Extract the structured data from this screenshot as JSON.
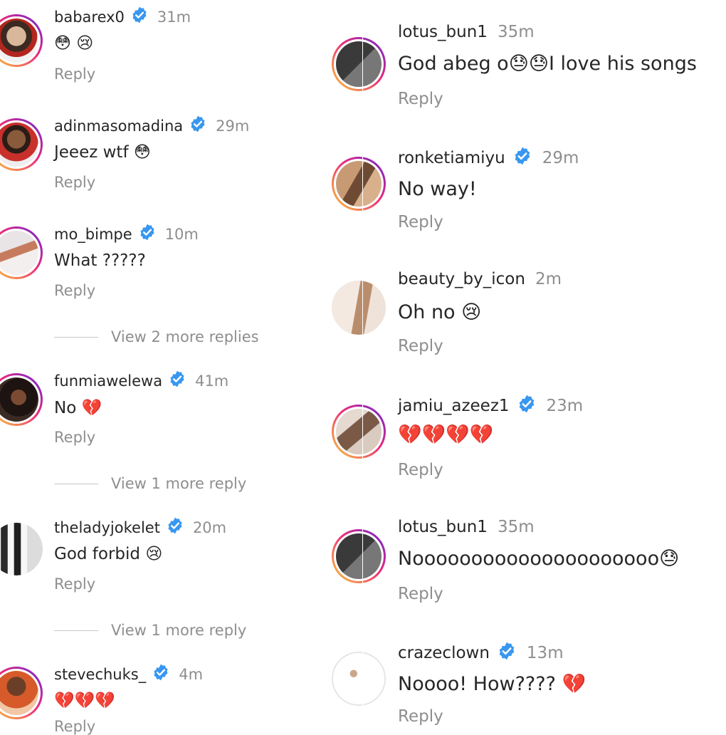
{
  "left_comments": [
    {
      "username": "babarex0",
      "verified": true,
      "time": "31m",
      "text": "😳 😢",
      "reply_label": "Reply"
    },
    {
      "username": "adinmasomadina",
      "verified": true,
      "time": "29m",
      "text": "Jeeez wtf 😳",
      "reply_label": "Reply"
    },
    {
      "username": "mo_bimpe",
      "verified": true,
      "time": "10m",
      "text": "What ?????",
      "reply_label": "Reply",
      "view_more": "View 2 more replies"
    },
    {
      "username": "funmiawelewa",
      "verified": true,
      "time": "41m",
      "text": "No 💔",
      "reply_label": "Reply",
      "view_more": "View 1 more reply"
    },
    {
      "username": "theladyjokelet",
      "verified": true,
      "time": "20m",
      "text": "God forbid 😢",
      "reply_label": "Reply",
      "view_more": "View 1 more reply"
    },
    {
      "username": "stevechuks_",
      "verified": true,
      "time": "4m",
      "text": "💔💔💔",
      "reply_label": "Reply"
    }
  ],
  "right_comments": [
    {
      "username": "lotus_bun1",
      "verified": false,
      "time": "35m",
      "text": "God abeg o😓😓I love his songs",
      "reply_label": "Reply"
    },
    {
      "username": "ronketiamiyu",
      "verified": true,
      "time": "29m",
      "text": "No way!",
      "reply_label": "Reply"
    },
    {
      "username": "beauty_by_icon",
      "verified": false,
      "time": "2m",
      "text": "Oh no 😢",
      "reply_label": "Reply"
    },
    {
      "username": "jamiu_azeez1",
      "verified": true,
      "time": "23m",
      "text": "💔💔💔💔",
      "reply_label": "Reply"
    },
    {
      "username": "lotus_bun1",
      "verified": false,
      "time": "35m",
      "text": "Nooooooooooooooooooooo😓",
      "reply_label": "Reply"
    },
    {
      "username": "crazeclown",
      "verified": true,
      "time": "13m",
      "text": "Noooo! How???? 💔",
      "reply_label": "Reply"
    }
  ],
  "icons": {
    "verified_badge": "verified-badge-icon"
  },
  "colors": {
    "verified_blue": "#3897f0",
    "muted_text": "#8e8e8e",
    "primary_text": "#262626",
    "story_ring_start": "#f9ce34",
    "story_ring_mid": "#ee2a7b",
    "story_ring_end": "#6228d7"
  }
}
